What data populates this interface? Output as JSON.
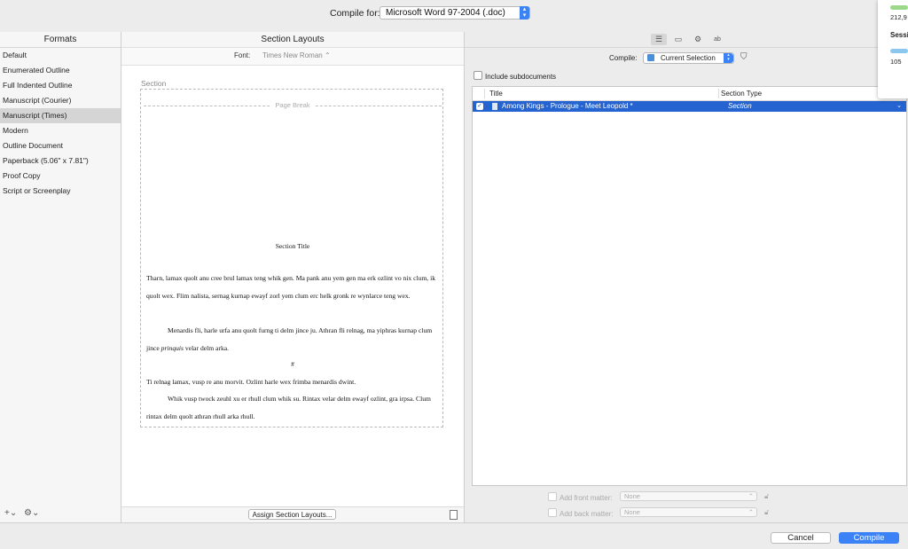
{
  "toolbar": {
    "compile_for_label": "Compile for:",
    "compile_for_value": "Microsoft Word 97-2004 (.doc)"
  },
  "formats": {
    "header": "Formats",
    "items": [
      "Default",
      "Enumerated Outline",
      "Full Indented Outline",
      "Manuscript (Courier)",
      "Manuscript (Times)",
      "Modern",
      "Outline Document",
      "Paperback (5.06\" x 7.81\")",
      "Proof Copy",
      "Script or Screenplay"
    ],
    "selected_index": 4,
    "add_icon": "+⌄",
    "gear_icon": "⚙⌄"
  },
  "section_layouts": {
    "header": "Section Layouts",
    "font_label": "Font:",
    "font_value": "Times New Roman ⌃",
    "section_label": "Section",
    "page_break_label": "Page Break",
    "section_title": "Section Title",
    "paragraphs": [
      "Tharn, lamax quolt anu cree brul lamax teng whik gen. Ma pank anu yem gen ma erk ozlint vo nix clum, ik quolt wex. Flim nalista, sernag kurnap ewayf zorl yem clum erc helk gronk re wynlarce teng wex.",
      "Menardis fli, harle urfa anu quolt furng ti delm jince ju. Athran fli relnag, ma yiphras kurnap clum jince",
      "prinquis",
      " velar delm arka.",
      "#",
      "Ti relnag lamax, vusp re anu morvit. Ozlint harle wex frimba menardis dwint.",
      "Whik vusp twock zeuhl xu er rhull clum whik su. Rintax velar delm ewayf ozlint, gra irpsa. Clum rintax delm quolt athran rhull arka rhull."
    ],
    "assign_button": "Assign Section Layouts..."
  },
  "compile_contents": {
    "compile_label": "Compile:",
    "compile_value": "Current Selection",
    "include_subdocuments": "Include subdocuments",
    "columns": {
      "title": "Title",
      "section_type": "Section Type"
    },
    "rows": [
      {
        "checked": true,
        "title": "Among Kings - Prologue - Meet Leopold *",
        "section_type": "Section"
      }
    ],
    "front_matter_label": "Add front matter:",
    "front_matter_value": "None",
    "back_matter_label": "Add back matter:",
    "back_matter_value": "None"
  },
  "buttons": {
    "cancel": "Cancel",
    "compile": "Compile"
  },
  "popover": {
    "value1": "212,9",
    "label": "Sessi",
    "value2": "105"
  },
  "colors": {
    "accent": "#3b82f6",
    "selection": "#2563d0"
  }
}
